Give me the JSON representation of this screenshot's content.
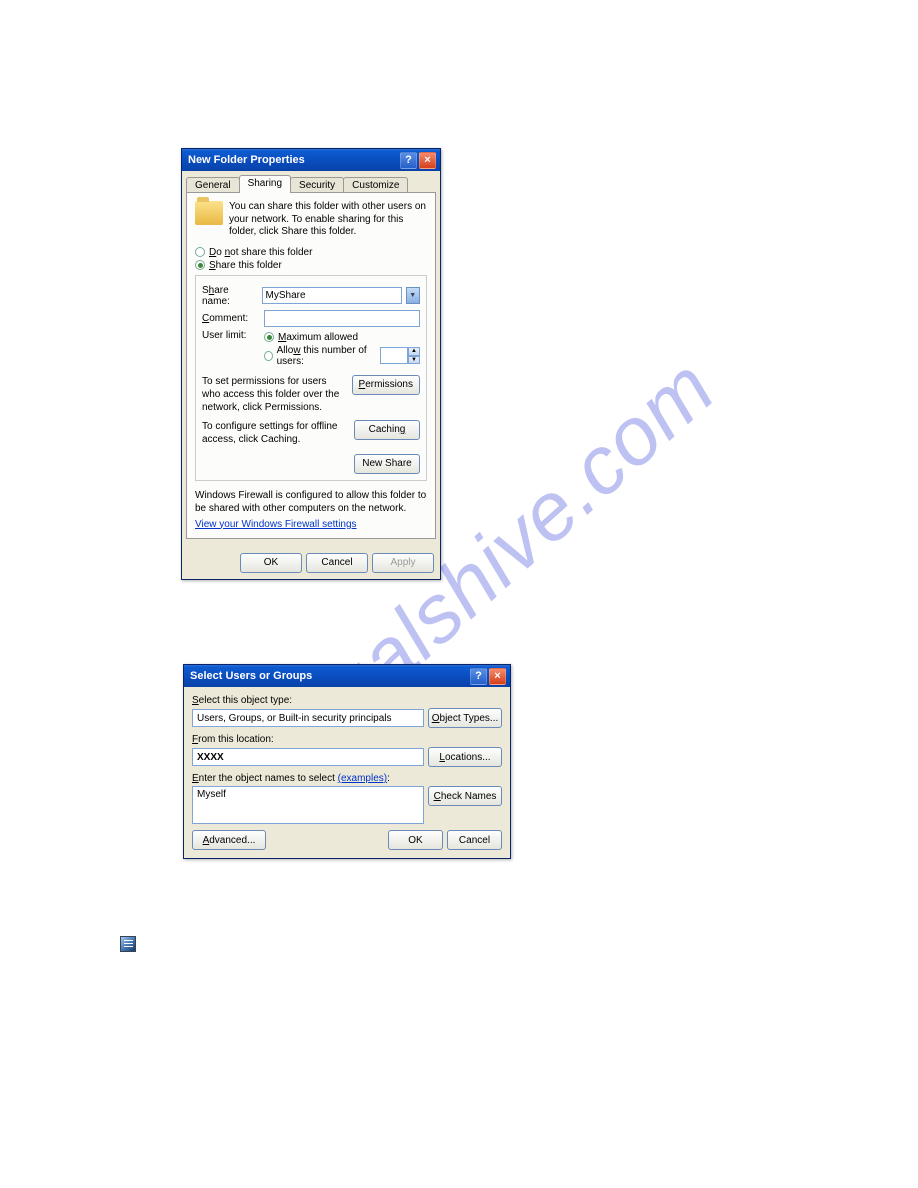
{
  "watermark_text": "manualshive.com",
  "dialog1": {
    "title": "New Folder Properties",
    "tabs": {
      "general": "General",
      "sharing": "Sharing",
      "security": "Security",
      "customize": "Customize"
    },
    "info_text": "You can share this folder with other users on your network. To enable sharing for this folder, click Share this folder.",
    "radio_dont_share": "Do not share this folder",
    "radio_share": "Share this folder",
    "share_name_label": "Share name:",
    "share_name_value": "MyShare",
    "comment_label": "Comment:",
    "comment_value": "",
    "user_limit_label": "User limit:",
    "radio_max_allowed": "Maximum allowed",
    "radio_allow_num": "Allow this number of users:",
    "permissions_text": "To set permissions for users who access this folder over the network, click Permissions.",
    "permissions_btn": "Permissions",
    "caching_text": "To configure settings for offline access, click Caching.",
    "caching_btn": "Caching",
    "new_share_btn": "New Share",
    "firewall_text": "Windows Firewall is configured to allow this folder to be shared with other computers on the network.",
    "firewall_link": "View your Windows Firewall settings",
    "ok_btn": "OK",
    "cancel_btn": "Cancel",
    "apply_btn": "Apply"
  },
  "dialog2": {
    "title": "Select Users or Groups",
    "select_type_label": "Select this object type:",
    "select_type_value": "Users, Groups, or Built-in security principals",
    "object_types_btn": "Object Types...",
    "location_label": "From this location:",
    "location_value": "XXXX",
    "locations_btn": "Locations...",
    "enter_names_label": "Enter the object names to select",
    "examples_link": "(examples)",
    "enter_names_value": "Myself",
    "check_names_btn": "Check Names",
    "advanced_btn": "Advanced...",
    "ok_btn": "OK",
    "cancel_btn": "Cancel"
  }
}
